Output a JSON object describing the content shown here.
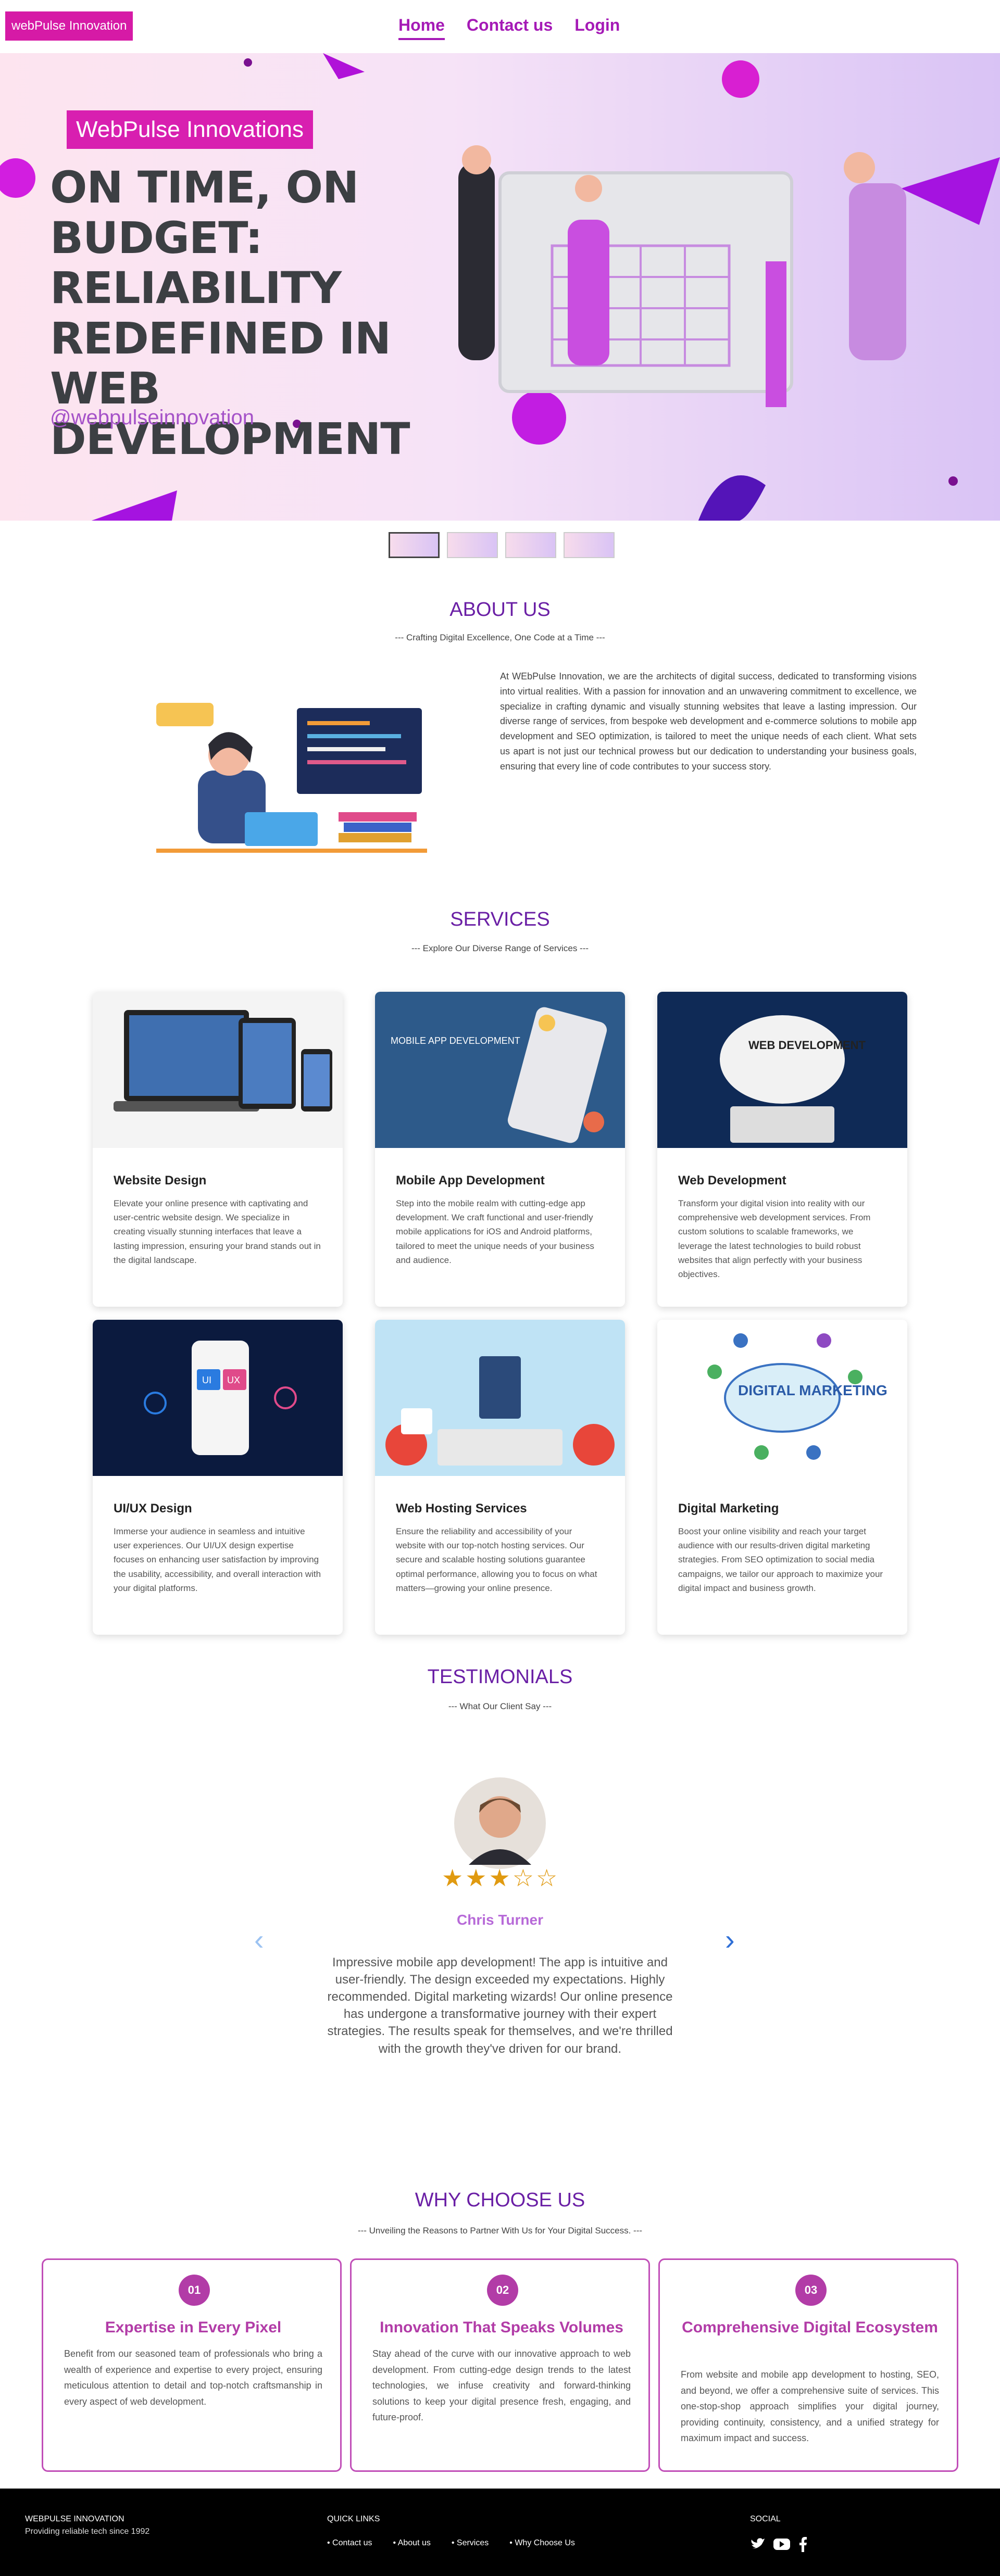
{
  "nav": {
    "brand": "webPulse Innovation",
    "links": [
      "Home",
      "Contact us",
      "Login"
    ]
  },
  "hero": {
    "tag": "WebPulse Innovations",
    "title": "ON TIME, ON BUDGET: RELIABILITY REDEFINED IN WEB DEVELOPMENT",
    "handle": "@webpulseinnovation"
  },
  "about": {
    "title": "ABOUT US",
    "subtitle": "--- Crafting Digital Excellence, One Code at a Time ---",
    "text": "At WEbPulse Innovation, we are the architects of digital success, dedicated to transforming visions into virtual realities. With a passion for innovation and an unwavering commitment to excellence, we specialize in crafting dynamic and visually stunning websites that leave a lasting impression. Our diverse range of services, from bespoke web development and e-commerce solutions to mobile app development and SEO optimization, is tailored to meet the unique needs of each client. What sets us apart is not just our technical prowess but our dedication to understanding your business goals, ensuring that every line of code contributes to your success story."
  },
  "services": {
    "title": "SERVICES",
    "subtitle": "--- Explore Our Diverse Range of Services ---",
    "items": [
      {
        "title": "Website Design",
        "text": "Elevate your online presence with captivating and user-centric website design. We specialize in creating visually stunning interfaces that leave a lasting impression, ensuring your brand stands out in the digital landscape."
      },
      {
        "title": "Mobile App Development",
        "text": "Step into the mobile realm with cutting-edge app development. We craft functional and user-friendly mobile applications for iOS and Android platforms, tailored to meet the unique needs of your business and audience."
      },
      {
        "title": "Web Development",
        "text": "Transform your digital vision into reality with our comprehensive web development services. From custom solutions to scalable frameworks, we leverage the latest technologies to build robust websites that align perfectly with your business objectives."
      },
      {
        "title": "UI/UX Design",
        "text": "Immerse your audience in seamless and intuitive user experiences. Our UI/UX design expertise focuses on enhancing user satisfaction by improving the usability, accessibility, and overall interaction with your digital platforms."
      },
      {
        "title": "Web Hosting Services",
        "text": "Ensure the reliability and accessibility of your website with our top-notch hosting services. Our secure and scalable hosting solutions guarantee optimal performance, allowing you to focus on what matters—growing your online presence."
      },
      {
        "title": "Digital Marketing",
        "text": "Boost your online visibility and reach your target audience with our results-driven digital marketing strategies. From SEO optimization to social media campaigns, we tailor our approach to maximize your digital impact and business growth."
      }
    ],
    "image_captions": {
      "mobile": "MOBILE APP DEVELOPMENT",
      "web": "WEB DEVELOPMENT",
      "marketing": "DIGITAL MARKETING"
    }
  },
  "testimonials": {
    "title": "TESTIMONIALS",
    "subtitle": "--- What Our Client Say ---",
    "rating": 3,
    "max_rating": 5,
    "name": "Chris Turner",
    "quote": "Impressive mobile app development! The app is intuitive and user-friendly. The design exceeded my expectations. Highly recommended. Digital marketing wizards! Our online presence has undergone a transformative journey with their expert strategies. The results speak for themselves, and we're thrilled with the growth they've driven for our brand."
  },
  "why": {
    "title": "WHY CHOOSE US",
    "subtitle": "--- Unveiling the Reasons to Partner With Us for Your Digital Success. ---",
    "items": [
      {
        "num": "01",
        "title": "Expertise in Every Pixel",
        "text": "Benefit from our seasoned team of professionals who bring a wealth of experience and expertise to every project, ensuring meticulous attention to detail and top-notch craftsmanship in every aspect of web development."
      },
      {
        "num": "02",
        "title": "Innovation That Speaks Volumes",
        "text": "Stay ahead of the curve with our innovative approach to web development. From cutting-edge design trends to the latest technologies, we infuse creativity and forward-thinking solutions to keep your digital presence fresh, engaging, and future-proof."
      },
      {
        "num": "03",
        "title": "Comprehensive Digital Ecosystem",
        "text": "From website and mobile app development to hosting, SEO, and beyond, we offer a comprehensive suite of services. This one-stop-shop approach simplifies your digital journey, providing continuity, consistency, and a unified strategy for maximum impact and success."
      }
    ]
  },
  "footer": {
    "brand": "WEBPULSE INNOVATION",
    "since": "Providing reliable tech since 1992",
    "quick_title": "QUICK LINKS",
    "links": [
      "Contact us",
      "About us",
      "Services",
      "Why Choose Us"
    ],
    "social_title": "SOCIAL",
    "social_icons": [
      "twitter-icon",
      "youtube-icon",
      "facebook-icon"
    ]
  },
  "colors": {
    "brand": "#d61aa6",
    "accent": "#6a1fa5",
    "why": "#b23ca7"
  }
}
